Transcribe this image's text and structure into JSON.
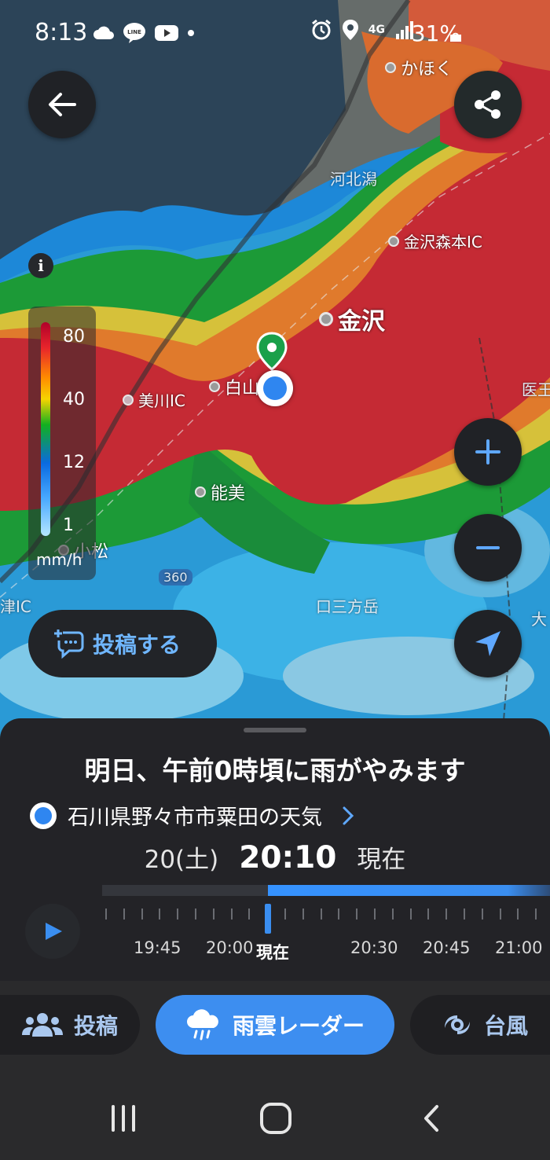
{
  "status_bar": {
    "time": "8:13",
    "battery": "31%",
    "network": "4G",
    "icons": [
      "cloud-icon",
      "line-app-icon",
      "youtube-icon",
      "dot-icon",
      "alarm-icon",
      "location-pin-icon",
      "signal-icon",
      "battery-icon"
    ]
  },
  "map": {
    "places": {
      "kahoku": "かほく",
      "kanazawa": "金沢",
      "hakusan": "白山",
      "mikawa_ic": "美川IC",
      "nomi": "能美",
      "komatsu": "小松",
      "kanazawa_morimoto_ic": "金沢森本IC",
      "kahokugata": "河北潟",
      "mt_kuchisannpou": "口三方岳",
      "io": "医王",
      "kaga_ic": "津IC",
      "route": "360",
      "ota": "大"
    },
    "legend": {
      "ticks": [
        "80",
        "40",
        "12",
        "1"
      ],
      "unit": "mm/h",
      "colors": [
        "#b1002a",
        "#e8252b",
        "#ff8c00",
        "#f6d400",
        "#12b020",
        "#0a6ae0",
        "#47a8ff",
        "#b5e6ff"
      ]
    },
    "post_button": "投稿する"
  },
  "forecast": {
    "headline": "明日、午前0時頃に雨がやみます",
    "location": "石川県野々市市粟田の天気",
    "date": "20(土)",
    "time": "20:10",
    "now_label": "現在"
  },
  "timeline": {
    "labels": [
      "19:45",
      "20:00",
      "現在",
      "20:30",
      "20:45",
      "21:00"
    ],
    "position_fraction": 0.37
  },
  "tabs": [
    {
      "label": "投稿",
      "icon": "users-icon",
      "active": false
    },
    {
      "label": "雨雲レーダー",
      "icon": "rain-cloud-icon",
      "active": true
    },
    {
      "label": "台風",
      "icon": "typhoon-icon",
      "active": false
    }
  ],
  "colors": {
    "accent": "#3d8ef0",
    "sheet": "#232327"
  }
}
